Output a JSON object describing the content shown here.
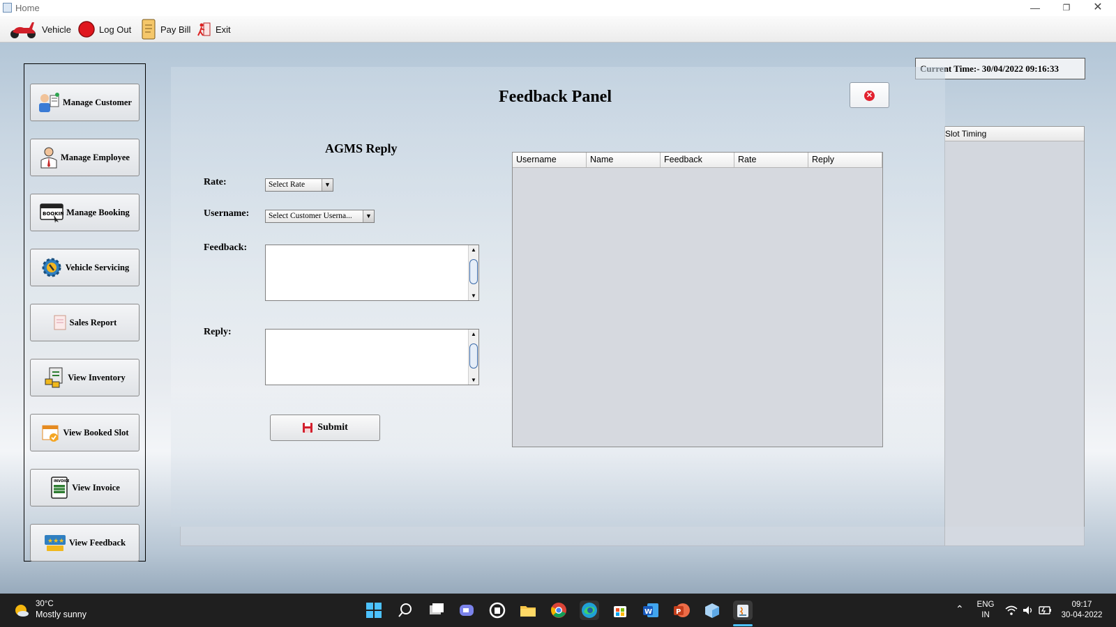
{
  "window": {
    "title": "Home"
  },
  "menubar": {
    "items": [
      {
        "label": "Vehicle",
        "icon": "scooter-icon"
      },
      {
        "label": "Log Out",
        "icon": "red-circle-icon"
      },
      {
        "label": "Pay Bill",
        "icon": "receipt-icon"
      },
      {
        "label": "Exit",
        "icon": "exit-person-icon"
      }
    ]
  },
  "sidebar": {
    "items": [
      {
        "label": "Manage Customer",
        "icon": "customer-icon"
      },
      {
        "label": "Manage Employee",
        "icon": "employee-icon"
      },
      {
        "label": "Manage Booking",
        "icon": "booking-icon"
      },
      {
        "label": "Vehicle Servicing",
        "icon": "gear-wrench-icon"
      },
      {
        "label": "Sales Report",
        "icon": "report-icon"
      },
      {
        "label": "View Inventory",
        "icon": "inventory-icon"
      },
      {
        "label": "View Booked Slot",
        "icon": "calendar-icon"
      },
      {
        "label": "View Invoice",
        "icon": "invoice-icon"
      },
      {
        "label": "View Feedback",
        "icon": "feedback-stars-icon"
      }
    ]
  },
  "current_time": "Current Time:- 30/04/2022 09:16:33",
  "background_table": {
    "header": "Slot Timing"
  },
  "panel": {
    "title": "Feedback Panel",
    "subtitle": "AGMS Reply",
    "rate_label": "Rate:",
    "rate_value": "Select Rate",
    "username_label": "Username:",
    "username_value": "Select Customer Userna...",
    "feedback_label": "Feedback:",
    "feedback_value": "",
    "reply_label": "Reply:",
    "reply_value": "",
    "submit_label": "Submit",
    "table": {
      "columns": [
        "Username",
        "Name",
        "Feedback",
        "Rate",
        "Reply"
      ],
      "rows": []
    }
  },
  "taskbar": {
    "weather_temp": "30°C",
    "weather_desc": "Mostly sunny",
    "lang_top": "ENG",
    "lang_bottom": "IN",
    "clock_time": "09:17",
    "clock_date": "30-04-2022"
  },
  "colors": {
    "accent_red": "#e2222f",
    "taskbar": "#1f1f1f"
  }
}
